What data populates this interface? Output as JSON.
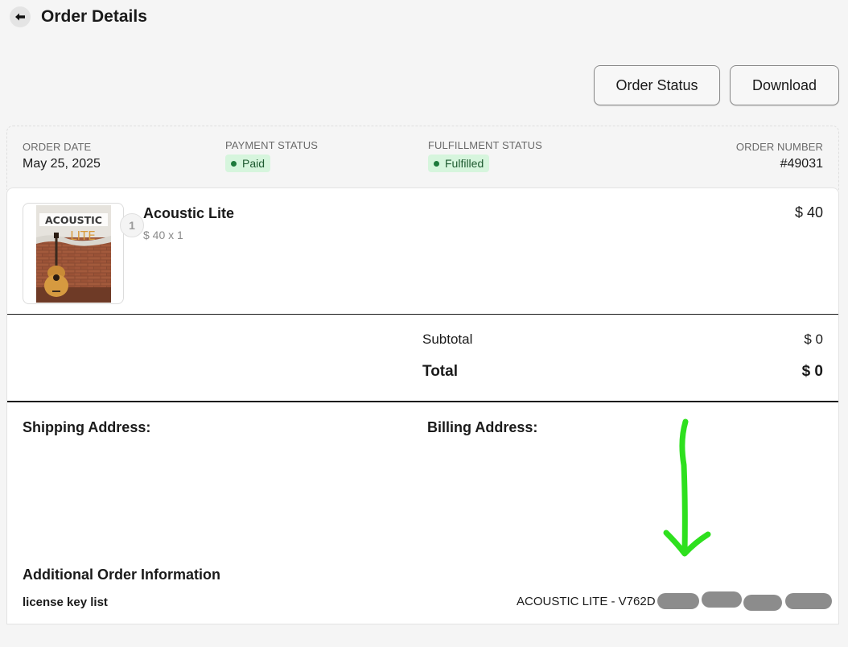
{
  "header": {
    "title": "Order Details"
  },
  "actions": {
    "order_status_label": "Order Status",
    "download_label": "Download"
  },
  "meta": {
    "order_date_label": "ORDER DATE",
    "order_date": "May 25, 2025",
    "payment_status_label": "PAYMENT STATUS",
    "payment_status": "Paid",
    "fulfillment_status_label": "FULFILLMENT STATUS",
    "fulfillment_status": "Fulfilled",
    "order_number_label": "ORDER NUMBER",
    "order_number": "#49031",
    "status_color": "#1e7a3c"
  },
  "item": {
    "quantity_badge": "1",
    "cover_title_line1": "ACOUSTIC",
    "cover_title_line2": "LITE",
    "name": "Acoustic Lite",
    "unit_line": "$ 40 x 1",
    "price": "$ 40"
  },
  "summary": {
    "subtotal_label": "Subtotal",
    "subtotal_value": "$ 0",
    "total_label": "Total",
    "total_value": "$ 0"
  },
  "addresses": {
    "shipping_label": "Shipping Address:",
    "billing_label": "Billing Address:"
  },
  "additional": {
    "heading": "Additional Order Information",
    "license_label": "license key list",
    "license_value": "ACOUSTIC LITE - V762D"
  },
  "annotation": {
    "arrow_color": "#2ee01e"
  }
}
